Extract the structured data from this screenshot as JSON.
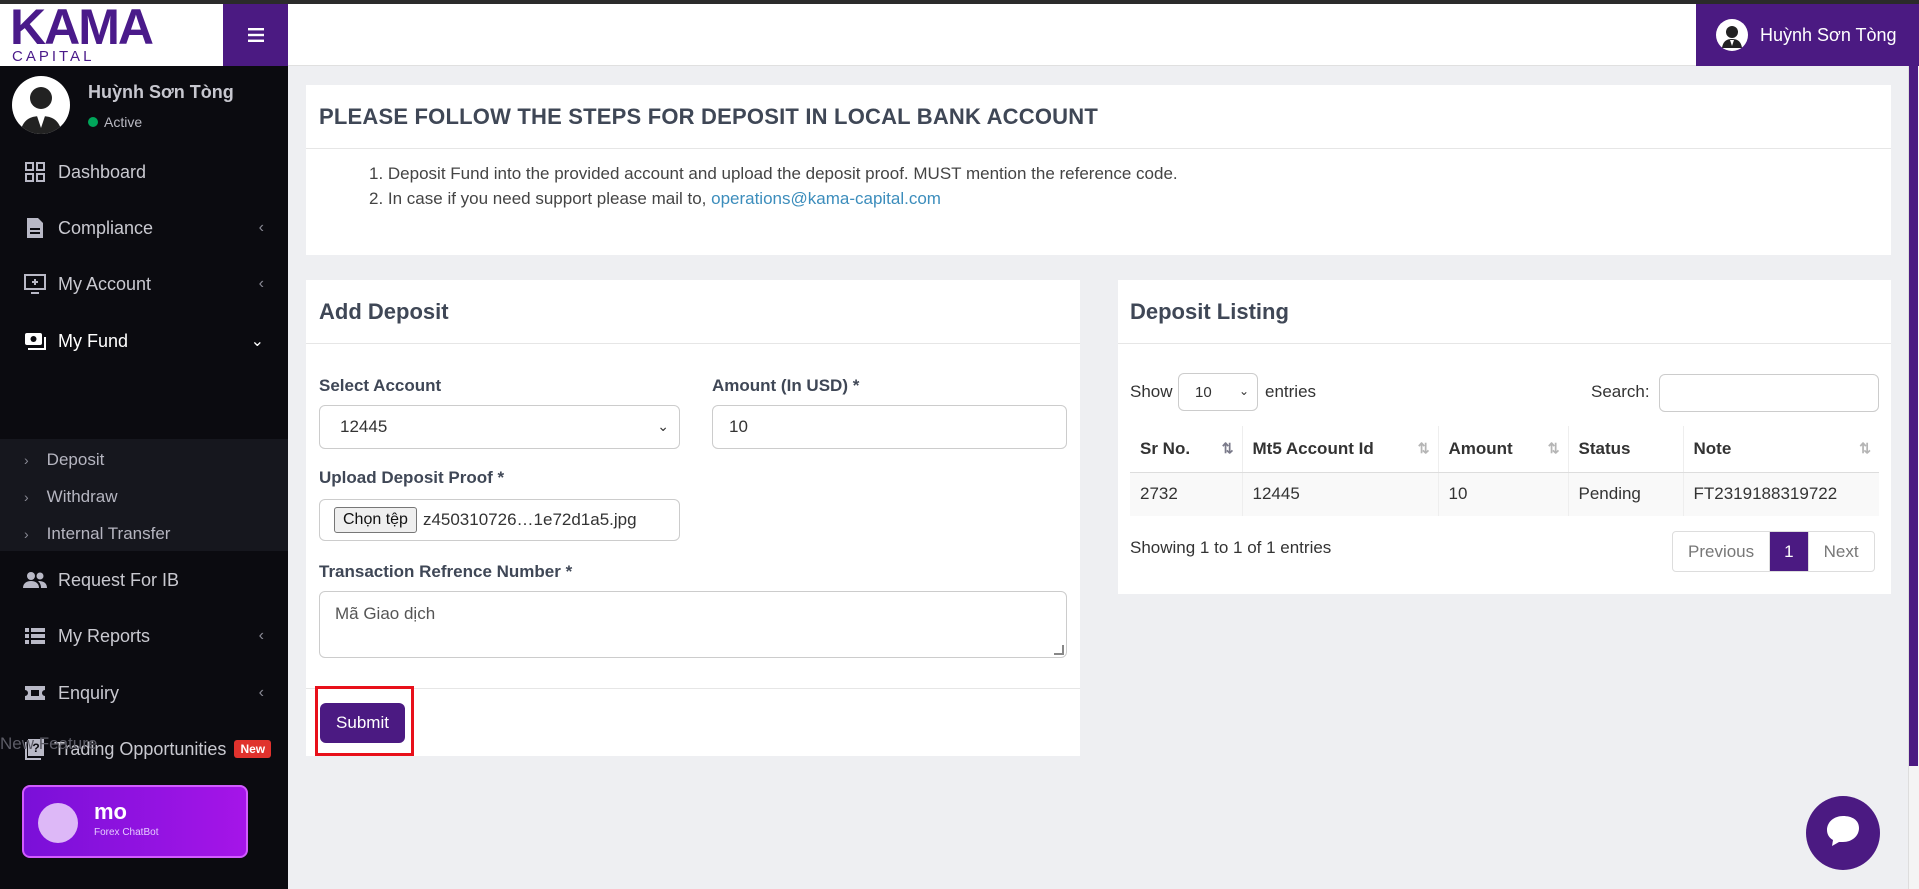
{
  "brand": {
    "logo": "KAMA",
    "sub": "CAPITAL",
    "accent": "#4b1a82"
  },
  "header": {
    "user_name": "Huỳnh Sơn Tòng"
  },
  "sidebar": {
    "profile": {
      "name": "Huỳnh Sơn Tòng",
      "status": "Active"
    },
    "items": [
      {
        "label": "Dashboard",
        "icon": "grid-icon"
      },
      {
        "label": "Compliance",
        "icon": "document-icon"
      },
      {
        "label": "My Account",
        "icon": "monitor-plus-icon"
      },
      {
        "label": "My Fund",
        "icon": "money-icon"
      },
      {
        "label": "Request For IB",
        "icon": "users-icon"
      },
      {
        "label": "My Reports",
        "icon": "list-icon"
      },
      {
        "label": "Enquiry",
        "icon": "ticket-icon"
      },
      {
        "label": "Trading Opportunities",
        "icon": "question-book-icon",
        "badge": "New"
      }
    ],
    "sub_items": [
      "Deposit",
      "Withdraw",
      "Internal Transfer"
    ],
    "new_feature": "New Feature",
    "chatbot": {
      "name": "mo",
      "caption": "Forex ChatBot"
    }
  },
  "steps": {
    "title": "PLEASE FOLLOW THE STEPS FOR DEPOSIT IN LOCAL BANK ACCOUNT",
    "line1": "Deposit Fund into the provided account and upload the deposit proof. MUST mention the reference code.",
    "line2_prefix": "In case if you need support please mail to,",
    "email": "operations@kama-capital.com"
  },
  "deposit_form": {
    "title": "Add Deposit",
    "select_account_label": "Select Account",
    "select_account_value": "12445",
    "amount_label": "Amount (In USD) *",
    "amount_value": "10",
    "upload_label": "Upload Deposit Proof *",
    "file_button": "Chọn tệp",
    "file_name": "z450310726…1e72d1a5.jpg",
    "ref_label": "Transaction Refrence Number *",
    "ref_value": "Mã Giao dịch",
    "submit_label": "Submit"
  },
  "listing": {
    "title": "Deposit Listing",
    "show_label": "Show",
    "entries_value": "10",
    "entries_label": "entries",
    "search_label": "Search:",
    "columns": [
      "Sr No.",
      "Mt5 Account Id",
      "Amount",
      "Status",
      "Note"
    ],
    "rows": [
      [
        "2732",
        "12445",
        "10",
        "Pending",
        "FT2319188319722"
      ]
    ],
    "info": "Showing 1 to 1 of 1 entries",
    "pager": {
      "prev": "Previous",
      "current": "1",
      "next": "Next"
    }
  }
}
